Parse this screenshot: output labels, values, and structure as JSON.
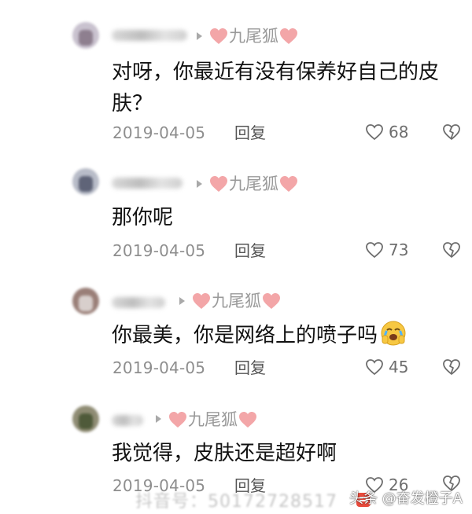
{
  "comments": [
    {
      "author": "九尾狐",
      "text_lines": [
        "对呀，你最近有没有保养好自己的皮",
        "肤？"
      ],
      "date": "2019-04-05",
      "reply_label": "回复",
      "likes": "68"
    },
    {
      "author": "九尾狐",
      "text_lines": [
        "那你呢"
      ],
      "date": "2019-04-05",
      "reply_label": "回复",
      "likes": "73"
    },
    {
      "author": "九尾狐",
      "text_lines": [
        "你最美，你是网络上的喷子吗"
      ],
      "date": "2019-04-05",
      "reply_label": "回复",
      "likes": "45",
      "emoji": "crying-face-emoji"
    },
    {
      "author": "九尾狐",
      "text_lines": [
        "我觉得，皮肤还是超好啊"
      ],
      "date": "2019-04-05",
      "reply_label": "回复",
      "likes": "26"
    }
  ],
  "watermark": {
    "left_text": "抖音号：50172728517",
    "right_text": "头条 @奋发橙子A"
  },
  "colors": {
    "heart_pink": "#f3a6a8",
    "text": "#111111",
    "muted": "#8e8e8e"
  }
}
